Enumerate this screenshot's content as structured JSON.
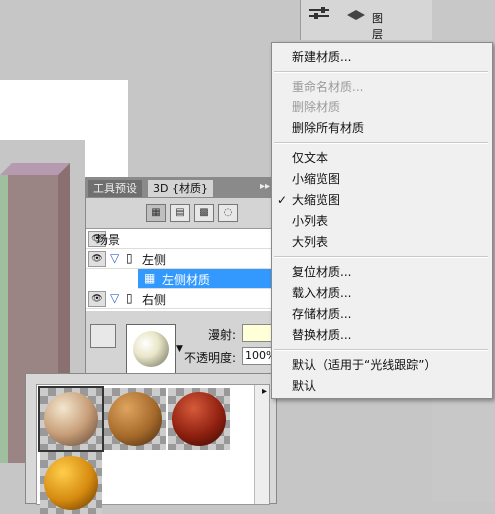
{
  "colors": {
    "menu_bg": "#f0f0f0",
    "selection": "#3399ff",
    "panel_bg": "#d4d4d4",
    "canvas": "#ffffff"
  },
  "top_panel": {
    "layers_label": "图层"
  },
  "panel": {
    "tabs": [
      {
        "label": "工具预设"
      },
      {
        "label": "3D {材质}"
      }
    ],
    "tree": [
      {
        "label": "场景"
      },
      {
        "label": "左侧"
      },
      {
        "label": "左侧材质"
      },
      {
        "label": "右侧"
      }
    ],
    "props": {
      "diffuse_label": "漫射:",
      "opacity_label": "不透明度:",
      "opacity_value": "100%"
    }
  },
  "menu": {
    "items": [
      {
        "label": "新建材质..."
      },
      {
        "label": "重命名材质..."
      },
      {
        "label": "删除材质"
      },
      {
        "label": "删除所有材质"
      },
      {
        "label": "仅文本"
      },
      {
        "label": "小缩览图"
      },
      {
        "label": "大缩览图"
      },
      {
        "label": "小列表"
      },
      {
        "label": "大列表"
      },
      {
        "label": "复位材质..."
      },
      {
        "label": "载入材质..."
      },
      {
        "label": "存储材质..."
      },
      {
        "label": "替换材质..."
      },
      {
        "label": "默认（适用于“光线跟踪”）"
      },
      {
        "label": "默认"
      }
    ],
    "checkmark": "✓"
  },
  "picker": {
    "materials": [
      {
        "icon": "wood-ball"
      },
      {
        "icon": "cork-ball"
      },
      {
        "icon": "red-ball"
      },
      {
        "icon": "orange-ball"
      }
    ]
  }
}
